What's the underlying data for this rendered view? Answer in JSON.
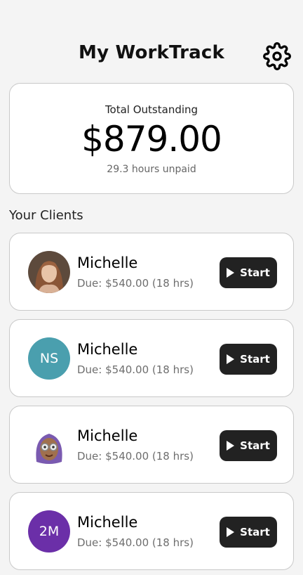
{
  "header": {
    "title": "My WorkTrack",
    "settings_icon": "gear-icon"
  },
  "summary": {
    "label": "Total Outstanding",
    "amount": "$879.00",
    "hours_unpaid": "29.3 hours unpaid"
  },
  "clients_section": {
    "title": "Your Clients"
  },
  "clients": [
    {
      "name": "Michelle",
      "due": "Due: $540.00 (18 hrs)",
      "avatar_type": "photo",
      "initials": "",
      "avatar_color": "#8a6a58",
      "button_label": "Start"
    },
    {
      "name": "Michelle",
      "due": "Due: $540.00 (18 hrs)",
      "avatar_type": "initials",
      "initials": "NS",
      "avatar_color": "#4a9fae",
      "button_label": "Start"
    },
    {
      "name": "Michelle",
      "due": "Due: $540.00 (18 hrs)",
      "avatar_type": "illustration",
      "initials": "",
      "avatar_color": "#7a5ab0",
      "button_label": "Start"
    },
    {
      "name": "Michelle",
      "due": "Due: $540.00 (18 hrs)",
      "avatar_type": "initials",
      "initials": "2M",
      "avatar_color": "#6b2fa8",
      "button_label": "Start"
    }
  ],
  "colors": {
    "background": "#f4f4f4",
    "card": "#ffffff",
    "button": "#222222"
  }
}
